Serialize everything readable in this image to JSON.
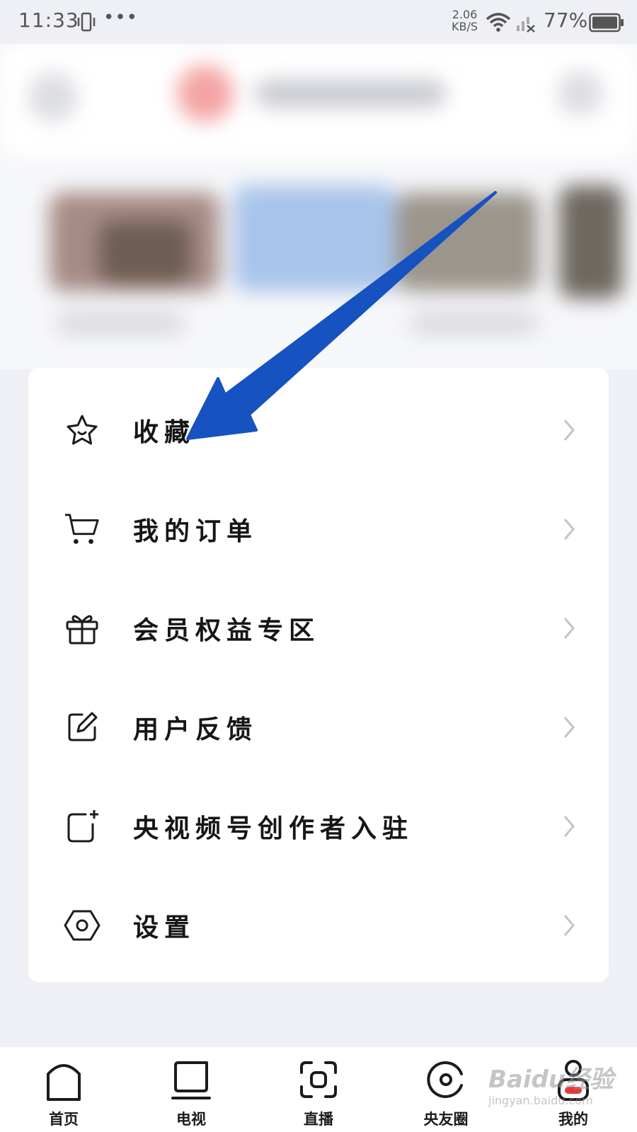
{
  "status_bar": {
    "time": "11:33",
    "more": "•••",
    "net_speed_value": "2.06",
    "net_speed_unit": "KB/S",
    "battery": "77%",
    "icons": [
      "vibrate-icon",
      "wifi-icon",
      "signal-no-sim-icon",
      "battery-icon"
    ]
  },
  "menu": {
    "items": [
      {
        "label": "收藏",
        "icon": "star-icon"
      },
      {
        "label": "我的订单",
        "icon": "cart-icon"
      },
      {
        "label": "会员权益专区",
        "icon": "gift-icon"
      },
      {
        "label": "用户反馈",
        "icon": "edit-icon"
      },
      {
        "label": "央视频号创作者入驻",
        "icon": "add-creator-icon"
      },
      {
        "label": "设置",
        "icon": "settings-hex-icon"
      }
    ]
  },
  "tab_bar": {
    "tabs": [
      {
        "label": "首页",
        "icon": "home-icon"
      },
      {
        "label": "电视",
        "icon": "tv-icon"
      },
      {
        "label": "直播",
        "icon": "live-scan-icon"
      },
      {
        "label": "央友圈",
        "icon": "circle-icon"
      },
      {
        "label": "我的",
        "icon": "profile-icon",
        "active": true
      }
    ]
  },
  "watermark": {
    "brand": "Baidu经验",
    "url": "jingyan.baidu.com"
  },
  "colors": {
    "annotation_arrow": "#1652c0",
    "background": "#eef0f5",
    "card": "#ffffff"
  }
}
